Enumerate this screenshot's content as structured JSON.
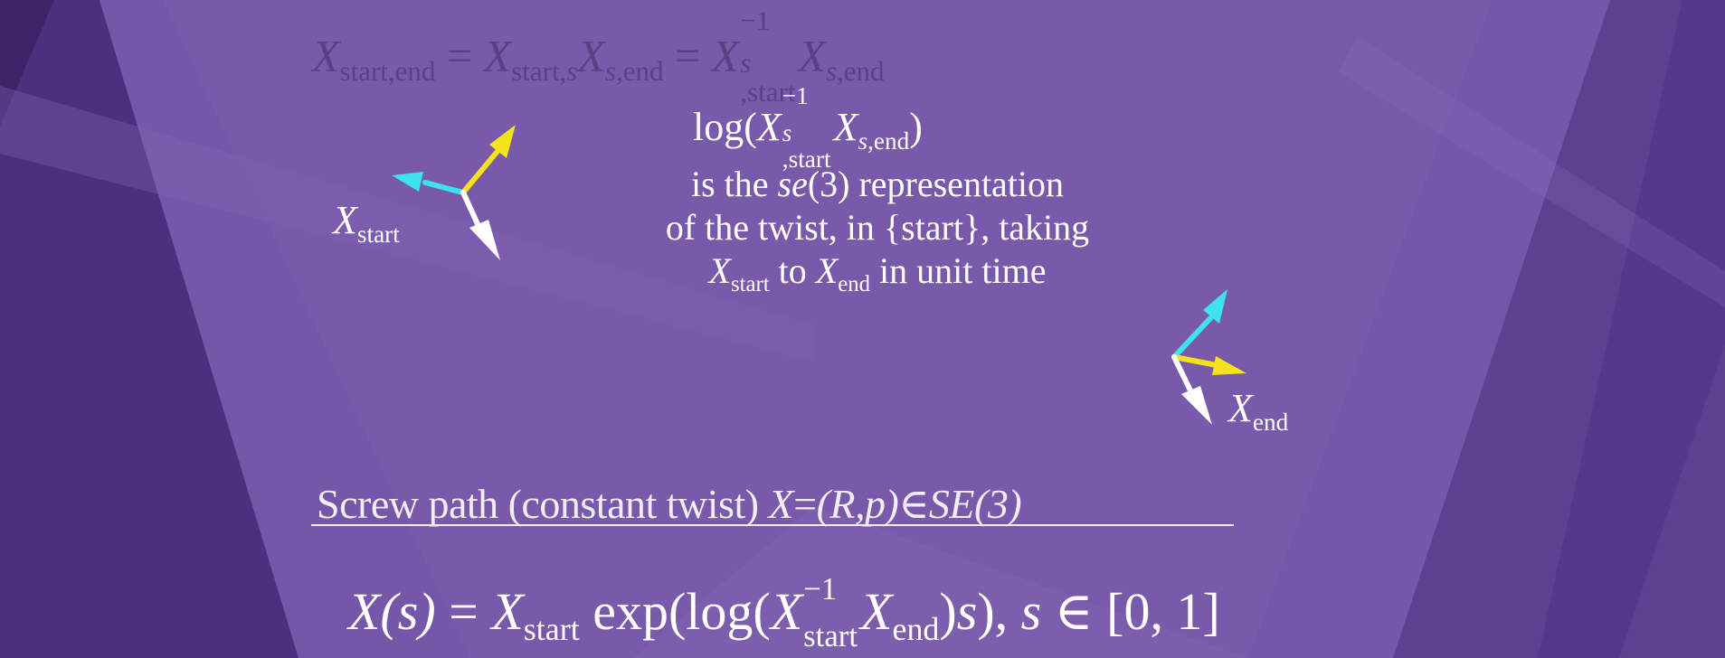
{
  "top_equation": {
    "X": "X",
    "eq": "=",
    "sub_start_end": "start,end",
    "sub_start_s": "start,",
    "sub_s_end_a": "s",
    "sub_s_end_b": ",end",
    "sup_minus_one": "−1",
    "sub_s_start_a": "s",
    "sub_s_start_b": ",start"
  },
  "center": {
    "log": "log(",
    "X": "X",
    "sup_minus_one": "−1",
    "sub_s": "s",
    "sub_start": ",start",
    "sub_end": ",end",
    "close_paren": ")",
    "line1_pre": "is the ",
    "line1_it": "se",
    "line1_post": "(3) representation",
    "line2": "of the twist, in {start}, taking",
    "line3_to": " to ",
    "line3_post": " in unit time",
    "start": "start",
    "end": "end"
  },
  "frames": {
    "start_label_X": "X",
    "start_label_sub": "start",
    "end_label_X": "X",
    "end_label_sub": "end",
    "colors": {
      "axis_cyan": "#3fe0f0",
      "axis_yellow": "#f4e21a",
      "axis_white": "#ffffff"
    },
    "icons": [
      "frame-start-icon",
      "frame-end-icon"
    ]
  },
  "screw_heading": {
    "text": "Screw path (constant twist) ",
    "X": "X",
    "eq": "=",
    "tuple": "(R,p)",
    "in": "∈",
    "group": "SE(3)"
  },
  "main_equation": {
    "lhs": "X(s)",
    "eq": " = ",
    "X": "X",
    "start": "start",
    "exp": " exp(log(",
    "sup_minus_one": "−1",
    "end": "end",
    "close": ")",
    "s": "s",
    "close2": "), ",
    "s2": "s",
    "in": " ∈ ",
    "interval": "[0, 1]"
  },
  "colors": {
    "background": "#6f4fa0",
    "text": "#ffffff",
    "faint_text": "#4f3a78"
  }
}
